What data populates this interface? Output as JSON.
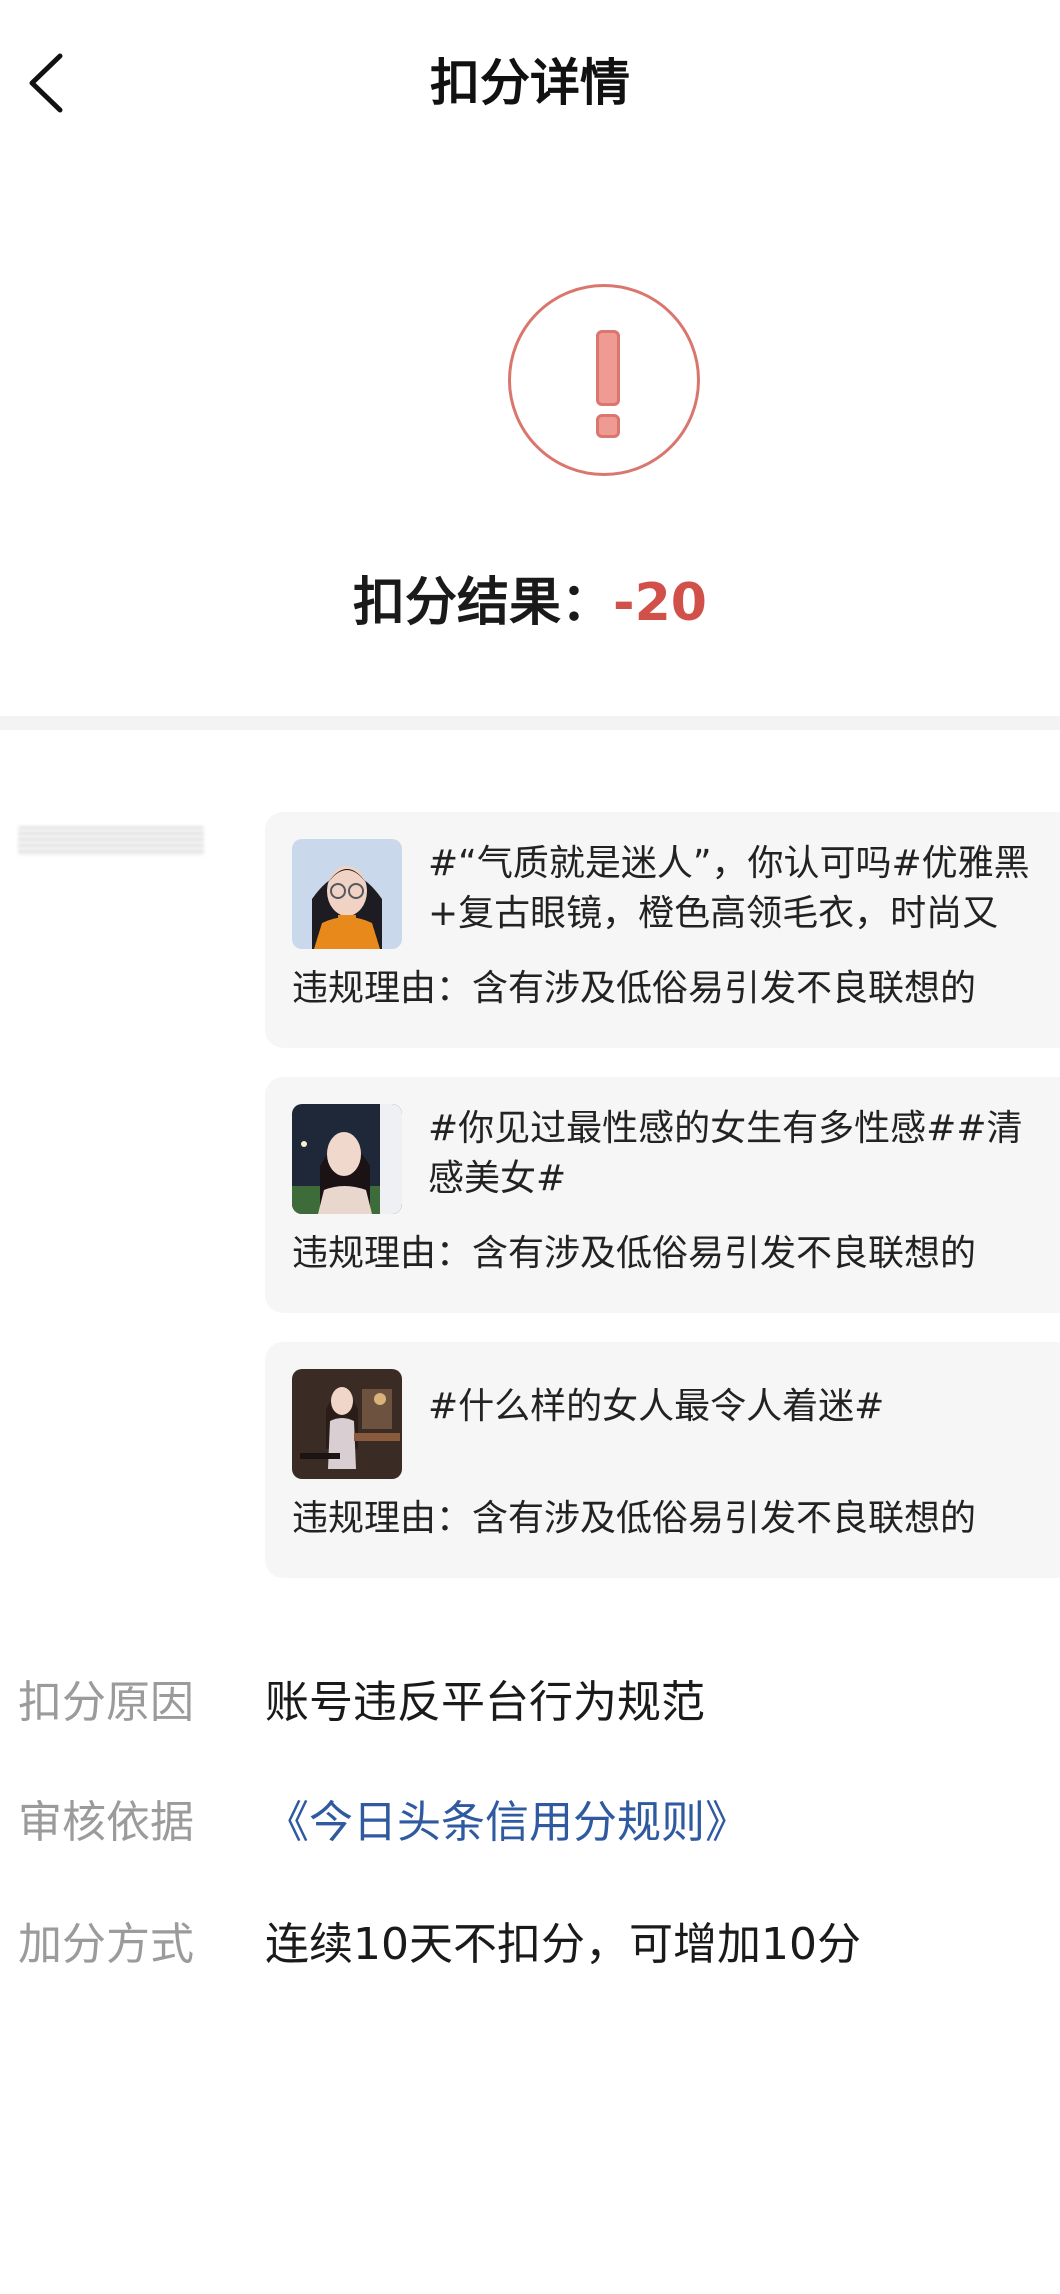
{
  "header": {
    "title": "扣分详情"
  },
  "hero": {
    "result_label": "扣分结果：",
    "result_value": "-20"
  },
  "posts": [
    {
      "title_line1": "#“气质就是迷人”，你认可吗#优雅黑",
      "title_line2": "+复古眼镜，橙色高领毛衣，时尚又",
      "reason": "违规理由：含有涉及低俗易引发不良联想的"
    },
    {
      "title_line1": "#你见过最性感的女生有多性感##清",
      "title_line2": "感美女#",
      "reason": "违规理由：含有涉及低俗易引发不良联想的"
    },
    {
      "title_line1": "#什么样的女人最令人着迷#",
      "title_line2": "",
      "reason": "违规理由：含有涉及低俗易引发不良联想的"
    }
  ],
  "info": {
    "reason_label": "扣分原因",
    "reason_value": "账号违反平台行为规范",
    "basis_label": "审核依据",
    "basis_value": "《今日头条信用分规则》",
    "bonus_label": "加分方式",
    "bonus_value": "连续10天不扣分，可增加10分"
  },
  "colors": {
    "accent_red": "#d2504a",
    "link_blue": "#2f5aa0",
    "label_gray": "#9b9b9b"
  }
}
